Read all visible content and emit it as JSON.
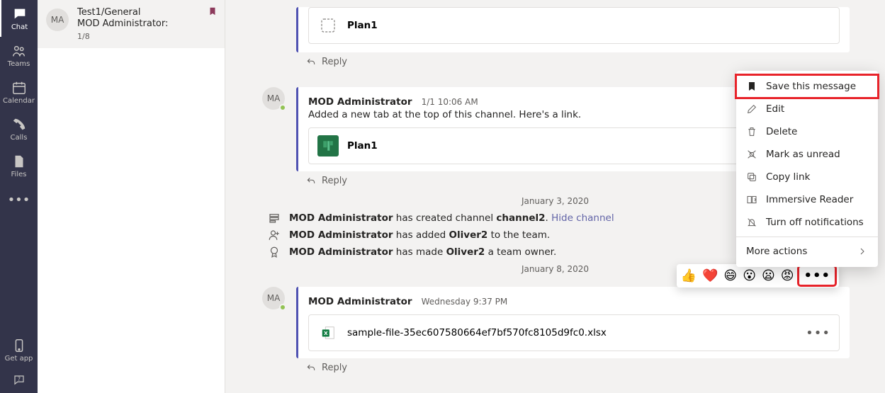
{
  "appbar": {
    "items": [
      {
        "icon": "chat",
        "label": "Chat"
      },
      {
        "icon": "teams",
        "label": "Teams"
      },
      {
        "icon": "calendar",
        "label": "Calendar"
      },
      {
        "icon": "calls",
        "label": "Calls"
      },
      {
        "icon": "files",
        "label": "Files"
      }
    ],
    "getapp": "Get app"
  },
  "channel": {
    "avatar": "MA",
    "title": "Test1/General",
    "subtitle": "MOD Administrator:",
    "badge": "1/8"
  },
  "messages": {
    "plan1": "Plan1",
    "reply": "Reply",
    "m2": {
      "avatar": "MA",
      "author": "MOD Administrator",
      "ts": "1/1 10:06 AM",
      "body": "Added a new tab at the top of this channel. Here's a link.",
      "card": "Plan1"
    },
    "divider1": "January 3, 2020",
    "sys1": {
      "a": "MOD Administrator",
      "b": " has created channel ",
      "c": "channel2",
      "d": ". ",
      "link": "Hide channel"
    },
    "sys2": {
      "a": "MOD Administrator",
      "b": " has added ",
      "c": "Oliver2",
      "d": " to the team."
    },
    "sys3": {
      "a": "MOD Administrator",
      "b": " has made ",
      "c": "Oliver2",
      "d": " a team owner."
    },
    "divider2": "January 8, 2020",
    "m3": {
      "avatar": "MA",
      "author": "MOD Administrator",
      "ts": "Wednesday 9:37 PM",
      "file": "sample-file-35ec607580664ef7bf570fc8105d9fc0.xlsx"
    }
  },
  "reactions": [
    "👍",
    "❤️",
    "😄",
    "😮",
    "😦",
    "😡"
  ],
  "menu": {
    "save": "Save this message",
    "edit": "Edit",
    "delete": "Delete",
    "unread": "Mark as unread",
    "copy": "Copy link",
    "reader": "Immersive Reader",
    "notif": "Turn off notifications",
    "more": "More actions"
  }
}
